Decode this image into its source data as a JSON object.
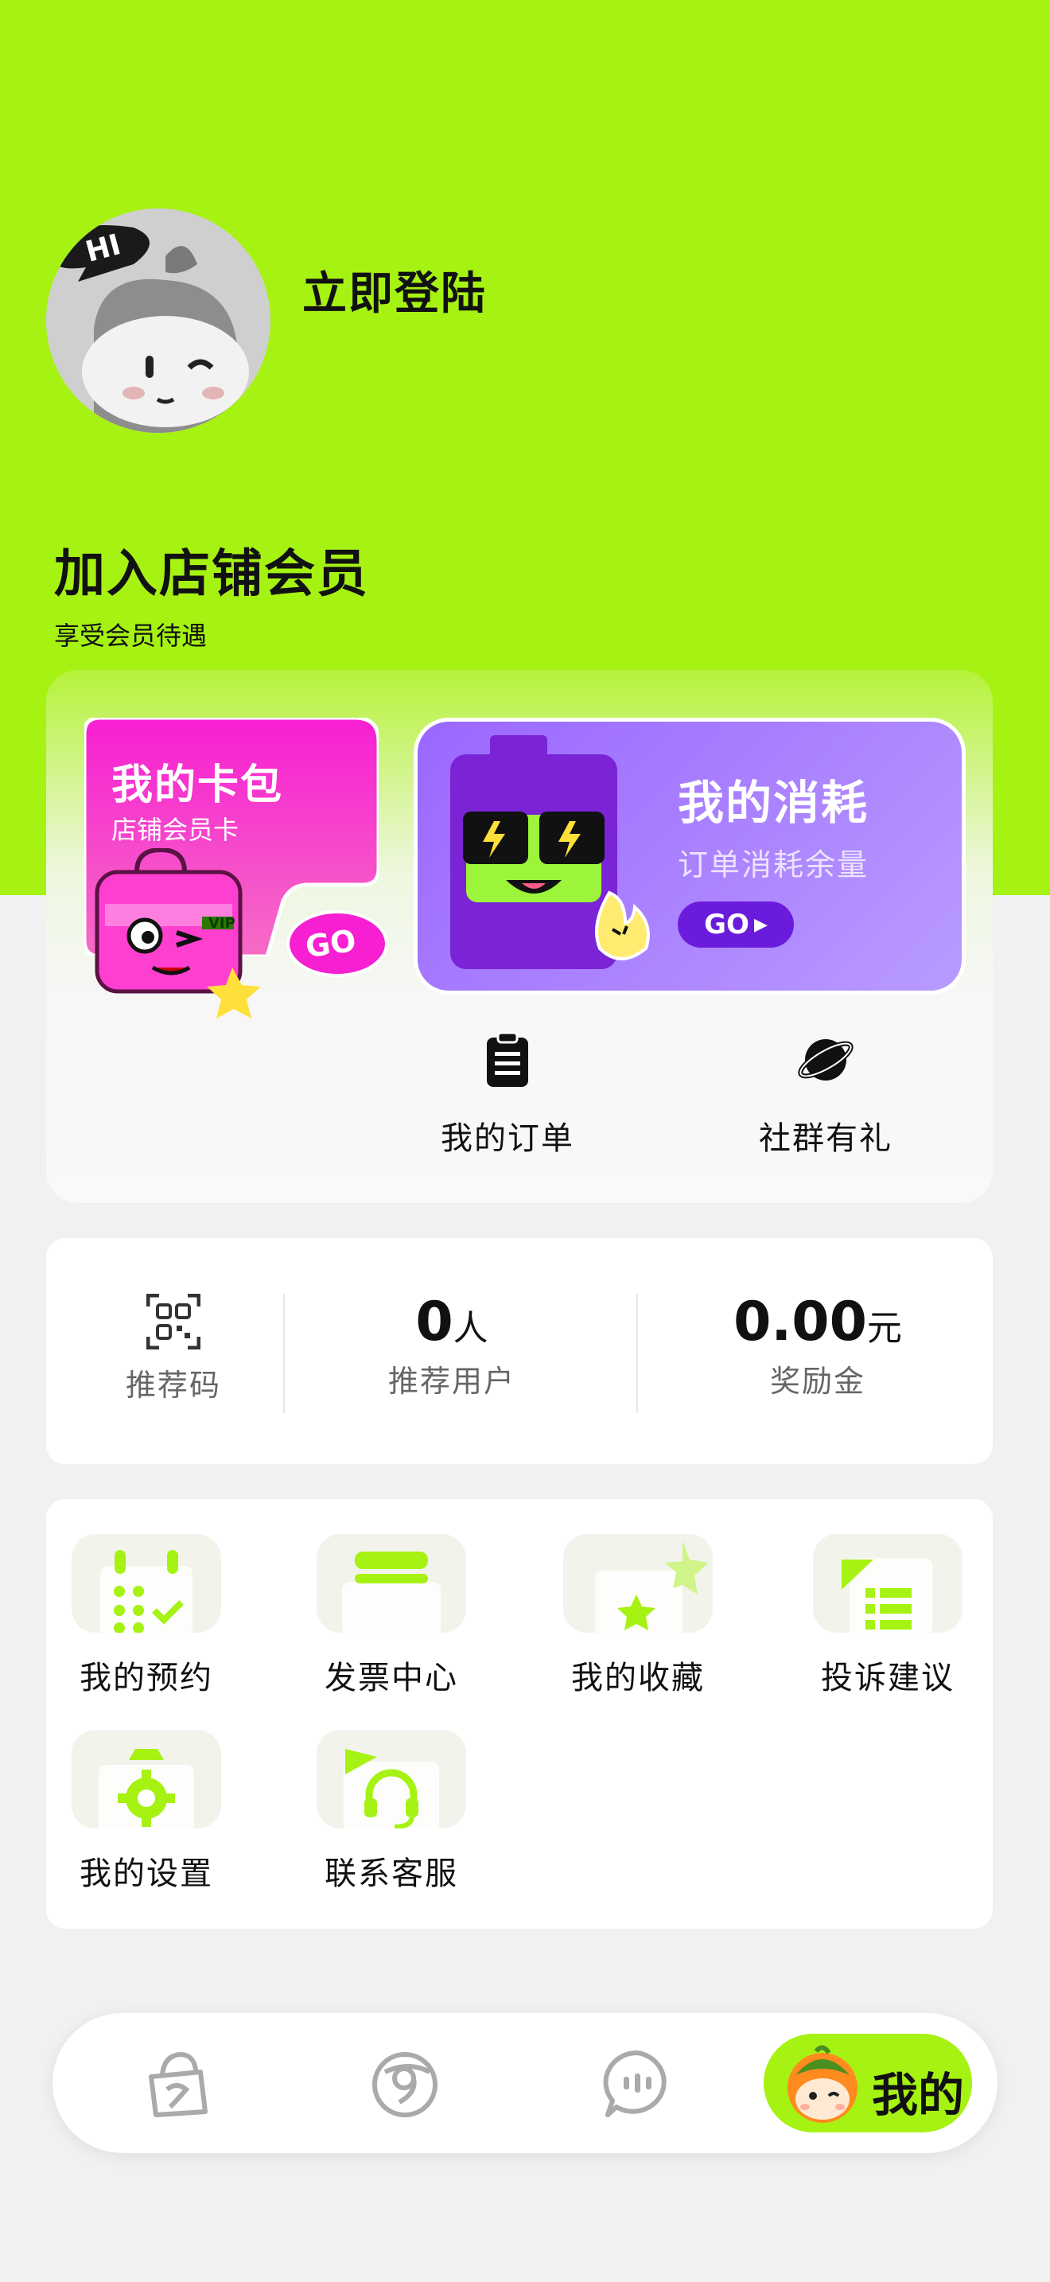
{
  "header": {
    "login_label": "立即登陆",
    "avatar_badge": "HI"
  },
  "membership": {
    "title": "加入店铺会员",
    "subtitle": "享受会员待遇"
  },
  "wallet_card": {
    "title": "我的卡包",
    "subtitle": "店铺会员卡",
    "go_label": "GO",
    "vip_tag": "VIP"
  },
  "consume_card": {
    "title": "我的消耗",
    "subtitle": "订单消耗余量",
    "go_label": "GO"
  },
  "quick_actions": [
    {
      "label": "我的订单",
      "icon": "clipboard-icon"
    },
    {
      "label": "社群有礼",
      "icon": "planet-icon"
    }
  ],
  "stats": {
    "referral_code": {
      "label": "推荐码",
      "icon": "qr-code-icon"
    },
    "referred_users": {
      "value": "0",
      "unit": "人",
      "label": "推荐用户"
    },
    "reward": {
      "value": "0.00",
      "unit": "元",
      "label": "奖励金"
    }
  },
  "services": [
    {
      "label": "我的预约",
      "icon": "calendar-check-icon"
    },
    {
      "label": "发票中心",
      "icon": "invoice-icon"
    },
    {
      "label": "我的收藏",
      "icon": "star-icon"
    },
    {
      "label": "投诉建议",
      "icon": "feedback-list-icon"
    },
    {
      "label": "我的设置",
      "icon": "gear-icon"
    },
    {
      "label": "联系客服",
      "icon": "headset-icon"
    }
  ],
  "tabbar": {
    "items": [
      {
        "icon": "shopping-bag-icon"
      },
      {
        "icon": "discover-icon"
      },
      {
        "icon": "chat-icon"
      },
      {
        "icon": "mascot-avatar-icon",
        "label": "我的"
      }
    ]
  },
  "colors": {
    "accent": "#a6f213",
    "pink": "#f018c8",
    "purple": "#9a67ff",
    "background": "#f1f1f1"
  }
}
